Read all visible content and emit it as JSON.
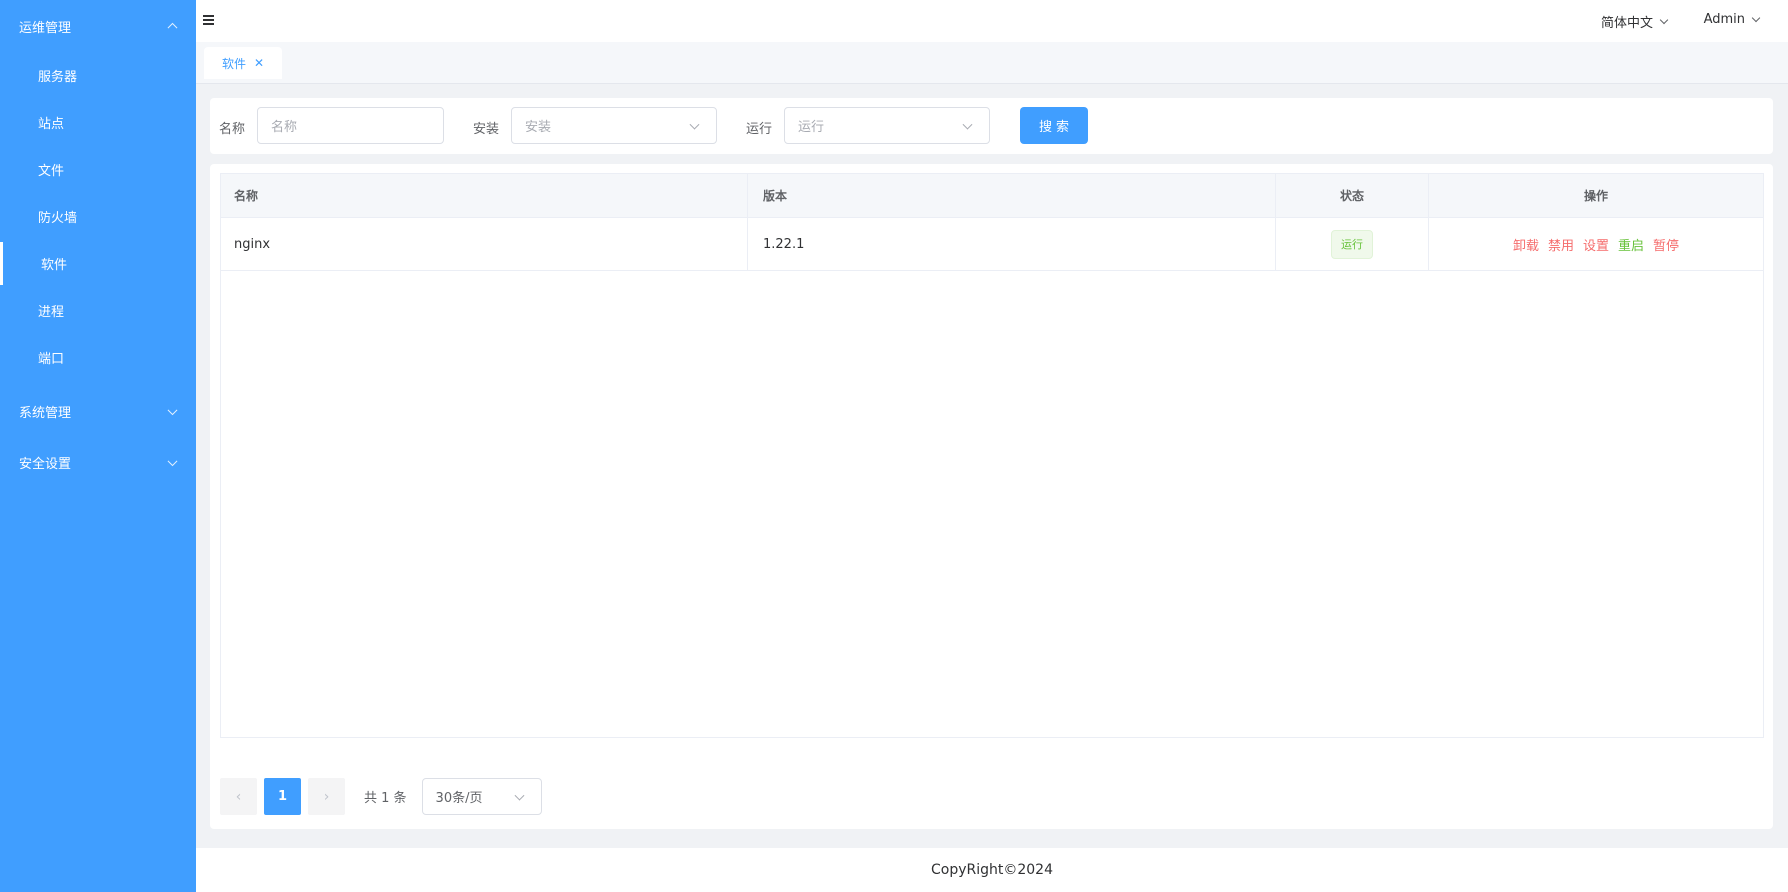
{
  "sidebar": {
    "groups": [
      {
        "label": "运维管理",
        "expanded": true
      },
      {
        "label": "系统管理",
        "expanded": false
      },
      {
        "label": "安全设置",
        "expanded": false
      }
    ],
    "items": [
      {
        "label": "服务器"
      },
      {
        "label": "站点"
      },
      {
        "label": "文件"
      },
      {
        "label": "防火墙"
      },
      {
        "label": "软件",
        "active": true
      },
      {
        "label": "进程"
      },
      {
        "label": "端口"
      }
    ]
  },
  "header": {
    "language": "简体中文",
    "user": "Admin"
  },
  "tabs": [
    {
      "label": "软件",
      "active": true
    }
  ],
  "filters": {
    "name_label": "名称",
    "name_placeholder": "名称",
    "install_label": "安装",
    "install_placeholder": "安装",
    "run_label": "运行",
    "run_placeholder": "运行",
    "search_label": "搜索"
  },
  "table": {
    "columns": [
      "名称",
      "版本",
      "状态",
      "操作"
    ],
    "rows": [
      {
        "name": "nginx",
        "version": "1.22.1",
        "status": "运行",
        "actions": [
          "卸载",
          "禁用",
          "设置",
          "重启",
          "暂停"
        ]
      }
    ]
  },
  "pagination": {
    "current_page": "1",
    "total_text": "共 1 条",
    "page_size": "30条/页"
  },
  "footer": {
    "copyright": "CopyRight©2024"
  },
  "colors": {
    "primary": "#409eff",
    "danger": "#f56c6c",
    "success": "#67c23a"
  }
}
